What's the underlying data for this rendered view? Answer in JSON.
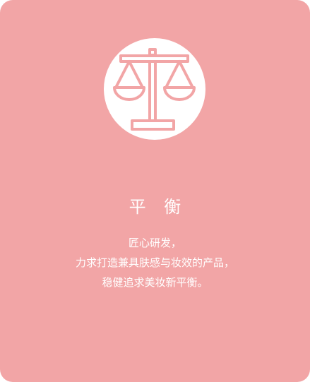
{
  "card": {
    "background_color": "#f2a5a6",
    "icon": "balance-scale-icon",
    "icon_color": "#f2a5a6",
    "title": "平 衡",
    "description_lines": [
      "匠心研发，",
      "力求打造兼具肤感与妆效的产品，",
      "稳健追求美妆新平衡。"
    ]
  }
}
